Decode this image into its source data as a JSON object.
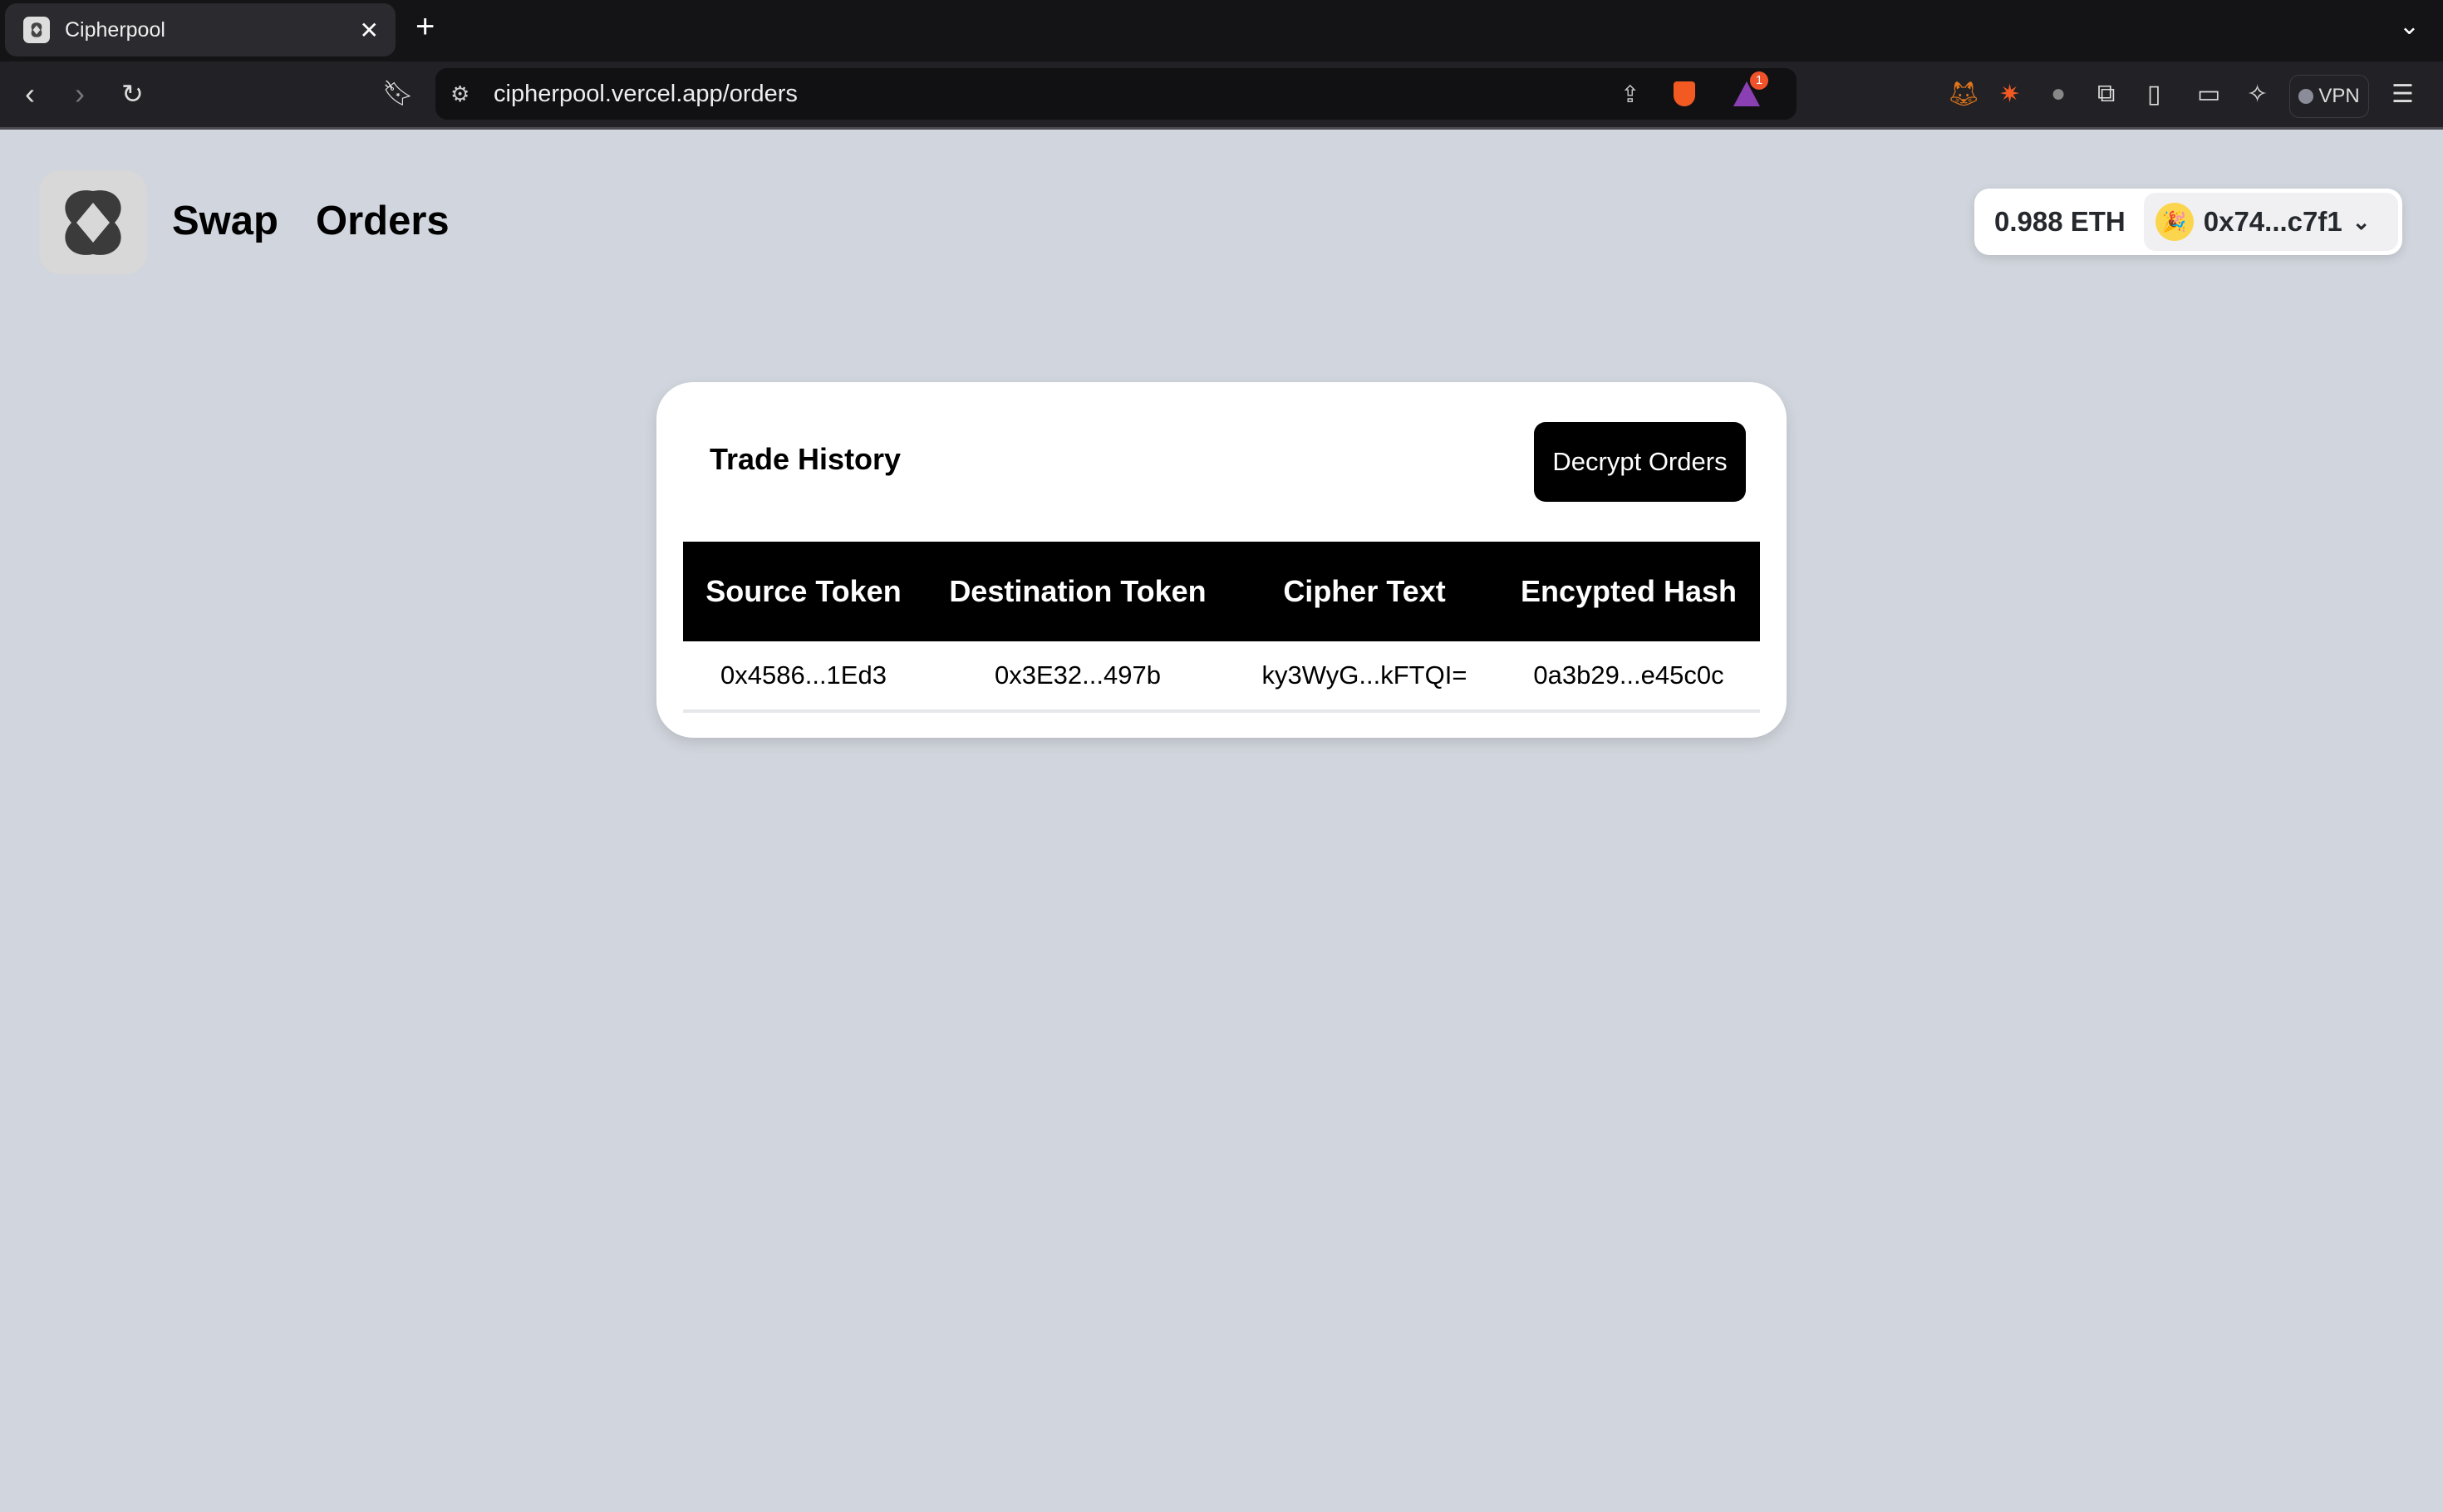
{
  "browser": {
    "tab_title": "Cipherpool",
    "url": "cipherpool.vercel.app/orders",
    "vpn_label": "VPN",
    "notification_count": "1"
  },
  "nav": {
    "items": [
      {
        "label": "Swap"
      },
      {
        "label": "Orders"
      }
    ]
  },
  "wallet": {
    "balance": "0.988 ETH",
    "address": "0x74...c7f1"
  },
  "card": {
    "title": "Trade History",
    "decrypt_button": "Decrypt Orders"
  },
  "table": {
    "columns": [
      "Source Token",
      "Destination Token",
      "Cipher Text",
      "Encypted Hash"
    ],
    "rows": [
      [
        "0x4586...1Ed3",
        "0x3E32...497b",
        "ky3WyG...kFTQI=",
        "0a3b29...e45c0c"
      ]
    ]
  }
}
